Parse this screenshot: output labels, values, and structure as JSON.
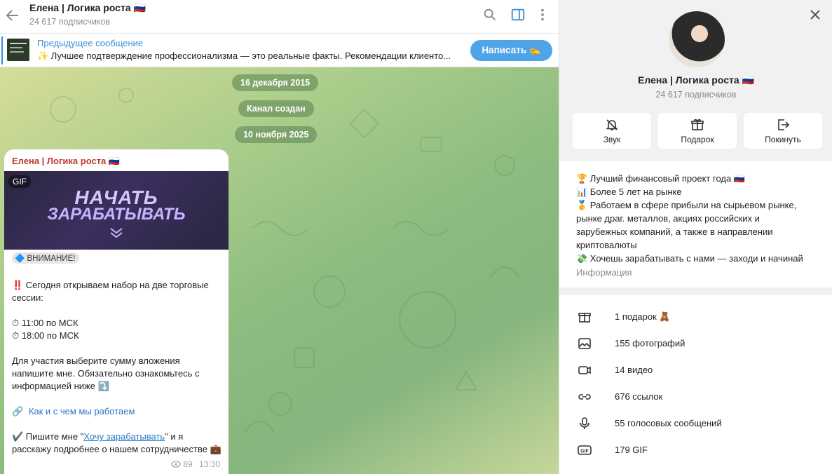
{
  "chat": {
    "title": "Елена | Логика роста 🇷🇺",
    "subtitle": "24 617 подписчиков",
    "pinned": {
      "title": "Предыдущее сообщение",
      "text": "✨ Лучшее подтверждение профессионализма — это реальные факты. Рекомендации клиенто...",
      "button": "Написать ✍️"
    },
    "dates": [
      "16 декабря 2015",
      "Канал создан",
      "10 ноября 2025"
    ],
    "message": {
      "author": "Елена | Логика роста 🇷🇺",
      "gif_badge": "GIF",
      "banner_line1": "НАЧАТЬ",
      "banner_line2": "ЗАРАБАТЫВАТЬ",
      "attention": "🔷 ВНИМАНИЕ!",
      "p1": "‼️ Сегодня открываем набор на две торговые сессии:",
      "t1": "⏱ 11:00 по МСК",
      "t2": "⏱ 18:00 по МСК",
      "p2": "Для участия выберите сумму вложения напишите мне. Обязательно ознакомьтесь с информацией ниже ⤵️",
      "link_icon": "🔗",
      "link": "Как и с чем мы работаем",
      "p3_pre": "✔️ Пишите мне \"",
      "p3_link": "Хочу зарабатывать",
      "p3_post": "\" и я расскажу подробнее о нашем сотрудничестве 💼",
      "views": "89",
      "time": "13:30"
    }
  },
  "panel": {
    "name": "Елена | Логика роста 🇷🇺",
    "subtitle": "24 617 подписчиков",
    "actions": [
      "Звук",
      "Подарок",
      "Покинуть"
    ],
    "about": [
      "🏆 Лучший финансовый проект года 🇷🇺",
      "📊 Более 5 лет на рынке",
      "🥇 Работаем в сфере прибыли на сырьевом рынке,",
      "рынке драг. металлов, акциях российских и",
      "зарубежных компаний, а также в направлении",
      "криптовалюты",
      "💸 Хочешь зарабатывать с нами — заходи и начинай"
    ],
    "about_label": "Информация",
    "media": [
      {
        "icon": "gift-icon",
        "label": "1 подарок 🧸"
      },
      {
        "icon": "photo-icon",
        "label": "155 фотографий"
      },
      {
        "icon": "video-icon",
        "label": "14 видео"
      },
      {
        "icon": "link-icon",
        "label": "676 ссылок"
      },
      {
        "icon": "microphone-icon",
        "label": "55 голосовых сообщений"
      },
      {
        "icon": "gif-icon",
        "label": "179 GIF"
      }
    ]
  },
  "colors": {
    "accent": "#4ea4e8",
    "link": "#2a77c9",
    "author": "#c0392b"
  }
}
